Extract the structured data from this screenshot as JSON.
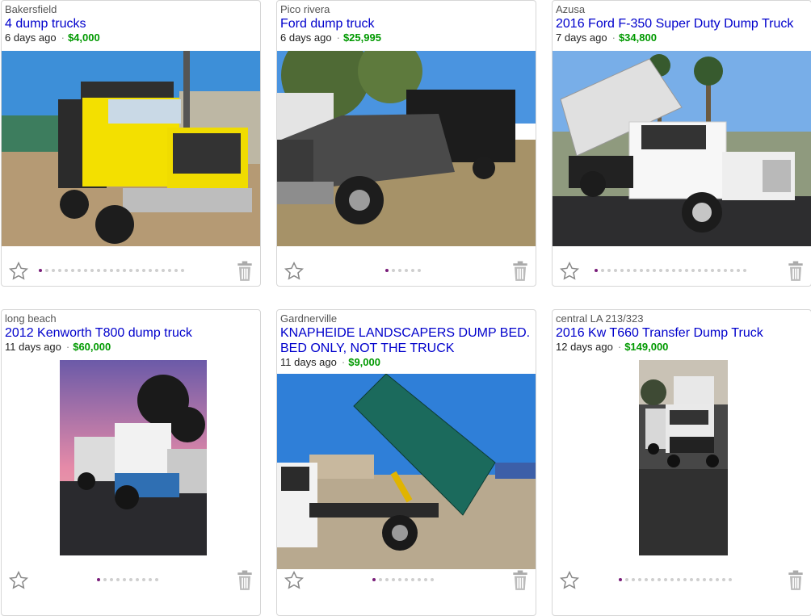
{
  "listings": [
    {
      "location": "Bakersfield",
      "title": "4 dump trucks",
      "age": "6 days ago",
      "price": "$4,000",
      "image_count": 23,
      "active_image": 1
    },
    {
      "location": "Pico rivera",
      "title": "Ford dump truck",
      "age": "6 days ago",
      "price": "$25,995",
      "image_count": 6,
      "active_image": 1
    },
    {
      "location": "Azusa",
      "title": "2016 Ford F-350 Super Duty Dump Truck",
      "age": "7 days ago",
      "price": "$34,800",
      "image_count": 24,
      "active_image": 1
    },
    {
      "location": "long beach",
      "title": "2012 Kenworth T800 dump truck",
      "age": "11 days ago",
      "price": "$60,000",
      "image_count": 10,
      "active_image": 1
    },
    {
      "location": "Gardnerville",
      "title": "KNAPHEIDE LANDSCAPERS DUMP BED. BED ONLY, NOT THE TRUCK",
      "age": "11 days ago",
      "price": "$9,000",
      "image_count": 10,
      "active_image": 1
    },
    {
      "location": "central LA 213/323",
      "title": "2016 Kw T660 Transfer Dump Truck",
      "age": "12 days ago",
      "price": "$149,000",
      "image_count": 18,
      "active_image": 1
    }
  ],
  "icons": {
    "favorite": "star-outline-icon",
    "hide": "trash-icon"
  },
  "colors": {
    "title_link": "#0000cc",
    "price": "#009900",
    "active_dot": "#7a1e7a"
  }
}
